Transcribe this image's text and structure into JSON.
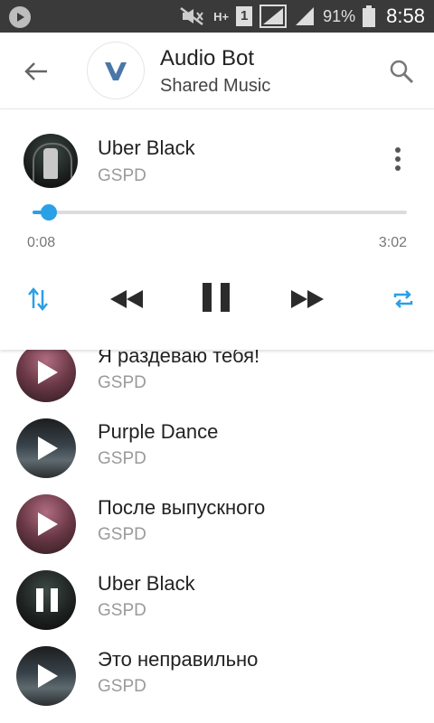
{
  "status_bar": {
    "battery_percent": "91%",
    "time": "8:58",
    "network_label": "H+",
    "sim_label": "1"
  },
  "app_bar": {
    "title": "Audio Bot",
    "subtitle": "Shared Music",
    "avatar_letter_icon": "vk-logo-icon"
  },
  "player": {
    "title": "Uber Black",
    "artist": "GSPD",
    "current_time": "0:08",
    "total_time": "3:02",
    "progress_fraction": 0.044,
    "accent_color": "#2aa0e6"
  },
  "tracks": [
    {
      "title": "Я раздеваю тебя!",
      "artist": "GSPD",
      "state": "play"
    },
    {
      "title": "Purple Dance",
      "artist": "GSPD",
      "state": "play"
    },
    {
      "title": "После выпускного",
      "artist": "GSPD",
      "state": "play"
    },
    {
      "title": "Uber Black",
      "artist": "GSPD",
      "state": "pause"
    },
    {
      "title": "Это неправильно",
      "artist": "GSPD",
      "state": "play"
    }
  ]
}
